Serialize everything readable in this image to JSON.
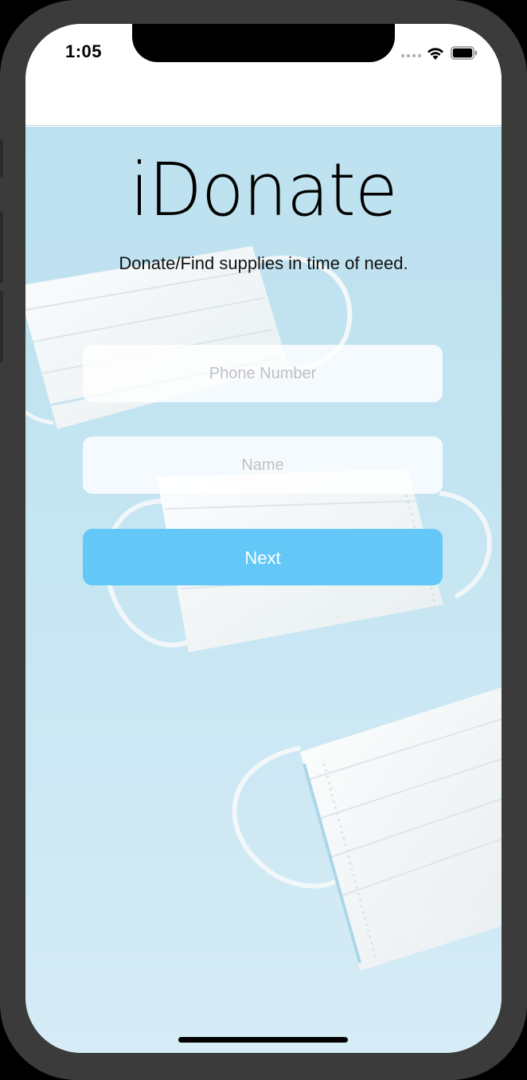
{
  "status_bar": {
    "time": "1:05"
  },
  "app": {
    "title": "iDonate",
    "subtitle": "Donate/Find supplies in time of need."
  },
  "form": {
    "phone_placeholder": "Phone Number",
    "name_placeholder": "Name",
    "next_label": "Next"
  },
  "colors": {
    "accent": "#63c8f7",
    "background": "#c5e5f2"
  },
  "icons": [
    "signal-icon",
    "wifi-icon",
    "battery-icon"
  ]
}
